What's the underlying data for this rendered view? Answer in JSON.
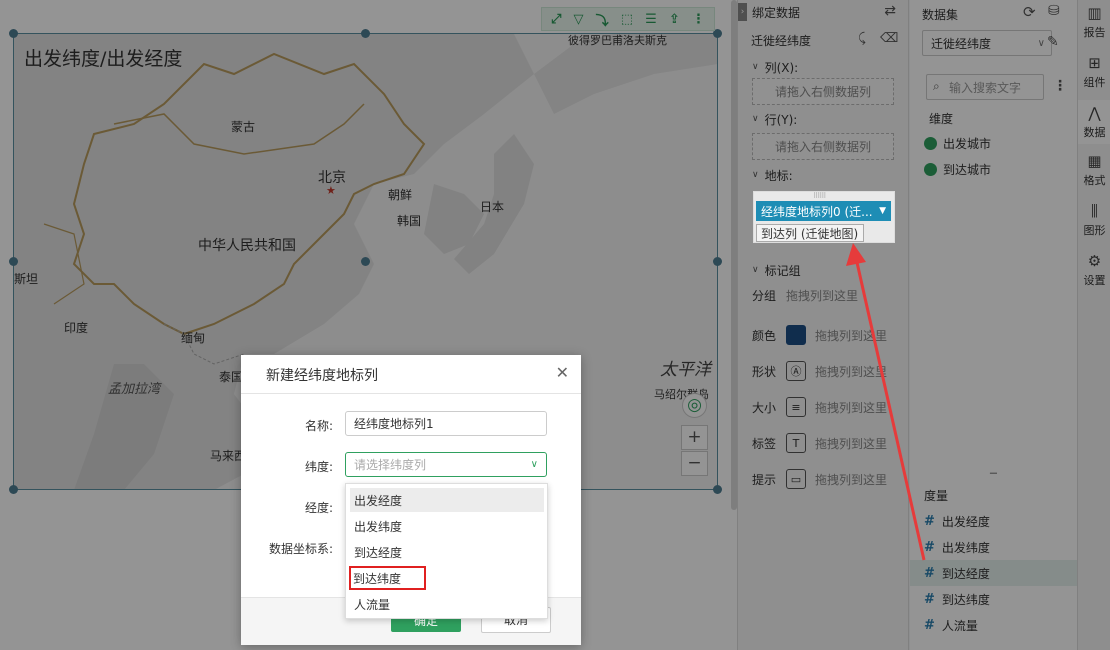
{
  "map": {
    "title": "出发纬度/出发经度",
    "labels": {
      "mongolia": "蒙古",
      "beijing": "北京",
      "korea_n": "朝鲜",
      "korea_s": "韩国",
      "japan": "日本",
      "china": "中华人民共和国",
      "india": "印度",
      "myanmar": "缅甸",
      "thailand": "泰国",
      "bay": "孟加拉湾",
      "pakistan": "斯坦",
      "pacific": "太平洋",
      "marshall": "马绍尔群岛",
      "malaysia": "马来西亚",
      "russia_city": "彼得罗巴甫洛夫斯克"
    },
    "controls": {
      "zoom_in": "+",
      "zoom_out": "−",
      "locate": "◎"
    }
  },
  "toolbar_icons": [
    "expand-icon",
    "filter-icon",
    "drill-icon",
    "select-icon",
    "list-icon",
    "export-icon",
    "more-icon"
  ],
  "bind_panel": {
    "title": "绑定数据",
    "chart_name": "迁徙经纬度",
    "columns_label": "列(X):",
    "columns_placeholder": "请拖入右侧数据列",
    "rows_label": "行(Y):",
    "rows_placeholder": "请拖入右侧数据列",
    "geo_label": "地标:",
    "geo_chip": "经纬度地标列0 (迁...",
    "geo_chip_sub": "到达列 (迁徙地图)",
    "markgroup_label": "标记组",
    "group_label": "分组",
    "group_hint": "拖拽列到这里",
    "marks": [
      {
        "label": "颜色",
        "hint": "拖拽列到这里"
      },
      {
        "label": "形状",
        "hint": "拖拽列到这里"
      },
      {
        "label": "大小",
        "hint": "拖拽列到这里"
      },
      {
        "label": "标签",
        "hint": "拖拽列到这里"
      },
      {
        "label": "提示",
        "hint": "拖拽列到这里"
      }
    ]
  },
  "data_panel": {
    "title": "数据集",
    "dataset": "迁徙经纬度",
    "search_placeholder": "输入搜索文字",
    "dimension_label": "维度",
    "dimensions": [
      "出发城市",
      "到达城市"
    ],
    "measure_label": "度量",
    "measures": [
      "出发经度",
      "出发纬度",
      "到达经度",
      "到达纬度",
      "人流量"
    ]
  },
  "icon_bar": {
    "items": [
      {
        "label": "报告",
        "icon": "report-icon"
      },
      {
        "label": "组件",
        "icon": "component-icon"
      },
      {
        "label": "数据",
        "icon": "data-icon"
      },
      {
        "label": "格式",
        "icon": "format-icon"
      },
      {
        "label": "图形",
        "icon": "graphic-icon"
      },
      {
        "label": "设置",
        "icon": "settings-icon"
      }
    ]
  },
  "dialog": {
    "title": "新建经纬度地标列",
    "name_label": "名称:",
    "name_value": "经纬度地标列1",
    "lat_label": "纬度:",
    "lat_placeholder": "请选择纬度列",
    "lng_label": "经度:",
    "crs_label": "数据坐标系:",
    "ok": "确定",
    "cancel": "取消",
    "options": [
      "出发经度",
      "出发纬度",
      "到达经度",
      "到达纬度",
      "人流量"
    ]
  },
  "colors": {
    "accent": "#2fa05f",
    "chip": "#1e8db5",
    "highlight": "#e02020"
  }
}
